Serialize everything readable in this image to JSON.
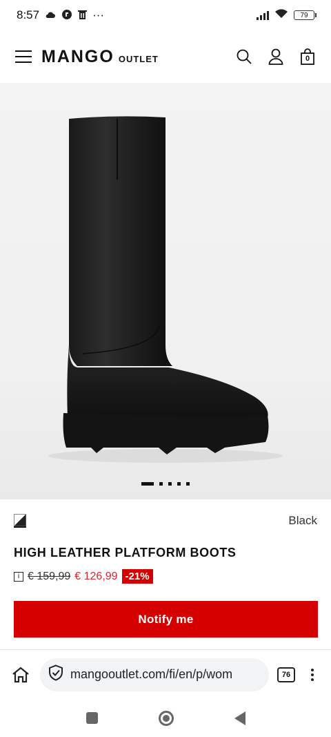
{
  "status_bar": {
    "time": "8:57",
    "icons": [
      "cloud-icon",
      "vpn-icon",
      "trash-icon",
      "more-dots-icon"
    ],
    "more": "···",
    "battery": "79"
  },
  "header": {
    "logo_main": "MANGO",
    "logo_sub": "OUTLET",
    "cart_count": "0"
  },
  "carousel": {
    "total_dots": 5,
    "active_index": 0
  },
  "product": {
    "color_name": "Black",
    "title": "HIGH LEATHER PLATFORM BOOTS",
    "info_mark": "i",
    "old_price": "€ 159,99",
    "new_price": "€ 126,99",
    "discount": "-21%",
    "notify_label": "Notify me"
  },
  "browser": {
    "url": "mangooutlet.com/fi/en/p/wom",
    "tabs_count": "76"
  },
  "colors": {
    "accent": "#d40000",
    "sale_price": "#d8262c"
  }
}
